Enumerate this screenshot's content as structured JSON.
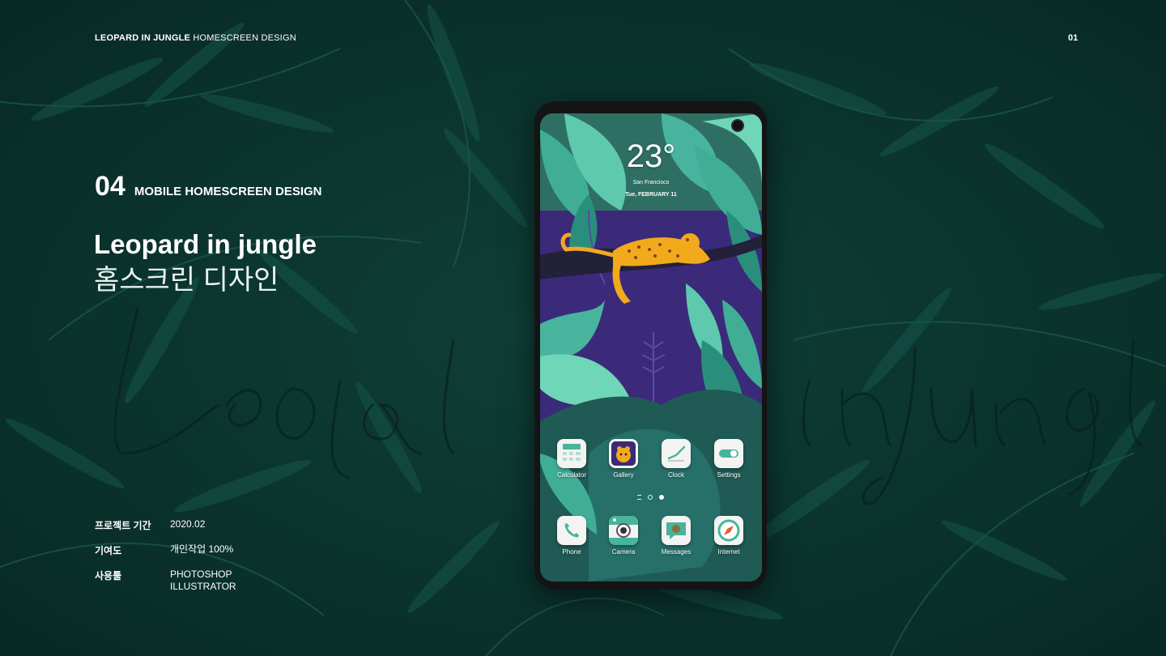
{
  "header": {
    "title_bold": "LEOPARD IN JUNGLE",
    "title_rest": " HOMESCREEN DESIGN",
    "page_number": "01"
  },
  "section": {
    "number": "04",
    "label": "MOBILE HOMESCREEN DESIGN"
  },
  "project_title": {
    "english": "Leopard in jungle",
    "korean": "홈스크린 디자인"
  },
  "info": [
    {
      "key": "프로젝트 기간",
      "value": "2020.02"
    },
    {
      "key": "기여도",
      "value": "개인작업 100%"
    },
    {
      "key": "사용툴",
      "value": "PHOTOSHOP",
      "value2": "ILLUSTRATOR"
    }
  ],
  "watermark_script": "Leopard in jungle",
  "phone": {
    "weather": {
      "temperature": "23°",
      "city": "San Francisco",
      "date": "Tue, FEBRUARY 11"
    },
    "apps_row1": [
      {
        "label": "Calculator",
        "icon": "calculator-icon"
      },
      {
        "label": "Gallery",
        "icon": "gallery-icon"
      },
      {
        "label": "Clock",
        "icon": "clock-icon"
      },
      {
        "label": "Settings",
        "icon": "settings-toggle-icon"
      }
    ],
    "apps_dock": [
      {
        "label": "Phone",
        "icon": "phone-icon"
      },
      {
        "label": "Camera",
        "icon": "camera-icon"
      },
      {
        "label": "Messages",
        "icon": "messages-icon"
      },
      {
        "label": "Internet",
        "icon": "compass-icon"
      }
    ]
  },
  "colors": {
    "background": "#0d3a34",
    "leaf_teal": "#3fae95",
    "leaf_light": "#5fc9ad",
    "jungle_purple": "#3b2a7a",
    "leopard_orange": "#f2a91c",
    "icon_teal": "#48b49e"
  }
}
